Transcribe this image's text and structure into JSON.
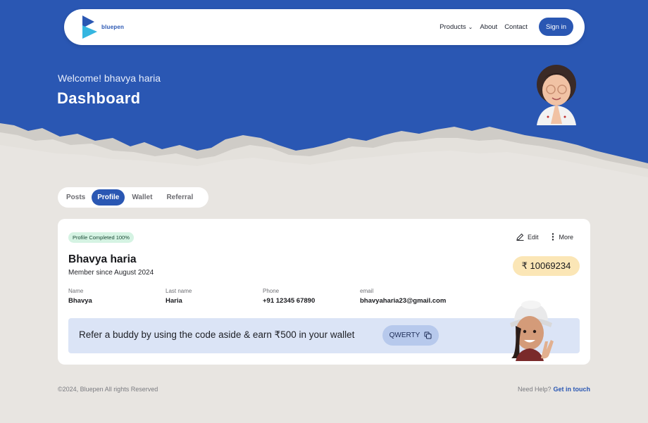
{
  "nav": {
    "logo_text": "bluepen",
    "links": [
      "Products",
      "About",
      "Contact"
    ],
    "signin": "Sign in"
  },
  "header": {
    "welcome": "Welcome! bhavya haria",
    "title": "Dashboard"
  },
  "tabs": [
    "Posts",
    "Profile",
    "Wallet",
    "Referral"
  ],
  "active_tab": "Profile",
  "profile": {
    "badge": "Profile Completed 100%",
    "edit": "Edit",
    "more": "More",
    "name": "Bhavya haria",
    "since": "Member since August 2024",
    "balance": "₹ 10069234",
    "fields": [
      {
        "label": "Name",
        "value": "Bhavya"
      },
      {
        "label": "Last name",
        "value": "Haria"
      },
      {
        "label": "Phone",
        "value": "+91 12345 67890"
      },
      {
        "label": "email",
        "value": "bhavyaharia23@gmail.com"
      }
    ]
  },
  "referral": {
    "text": "Refer a buddy by using the code aside & earn ₹500 in your wallet",
    "code": "QWERTY"
  },
  "footer": {
    "copyright": "©2024, Bluepen All rights Reserved",
    "help": "Need Help?",
    "help_link": "Get in touch"
  },
  "colors": {
    "primary": "#2a57b3",
    "background": "#e8e5e1",
    "badge_bg": "#d5f3e3",
    "balance_bg": "#fbe6b6",
    "referral_bg": "#dbe4f6"
  }
}
